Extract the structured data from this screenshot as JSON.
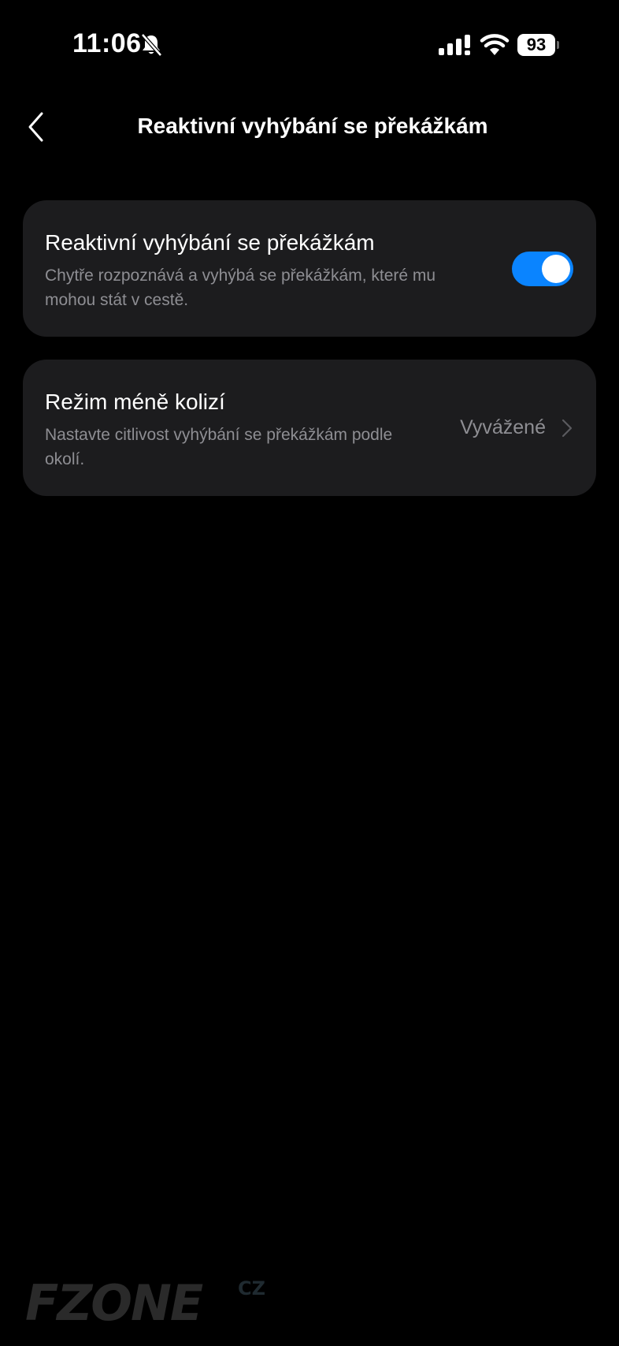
{
  "status_bar": {
    "time": "11:06",
    "battery": "93",
    "icons": [
      "bell-slash-icon",
      "signal-icon",
      "wifi-icon",
      "battery-icon"
    ]
  },
  "header": {
    "title": "Reaktivní vyhýbání se překážkám",
    "back_icon": "chevron-left-icon"
  },
  "settings": [
    {
      "title": "Reaktivní vyhýbání se překážkám",
      "description": "Chytře rozpoznává a vyhýbá se překážkám, které mu mohou stát v cestě.",
      "control": "toggle",
      "enabled": true
    },
    {
      "title": "Režim méně kolizí",
      "description": "Nastavte citlivost vyhýbání se překážkám podle okolí.",
      "value": "Vyvážené",
      "control": "chevron-right-icon"
    }
  ],
  "watermark": {
    "brand": "FZONE",
    "suffix": "CZ"
  },
  "colors": {
    "background": "#000000",
    "card": "#1c1c1e",
    "accent": "#0a84ff",
    "secondary_text": "#8e8e93"
  }
}
